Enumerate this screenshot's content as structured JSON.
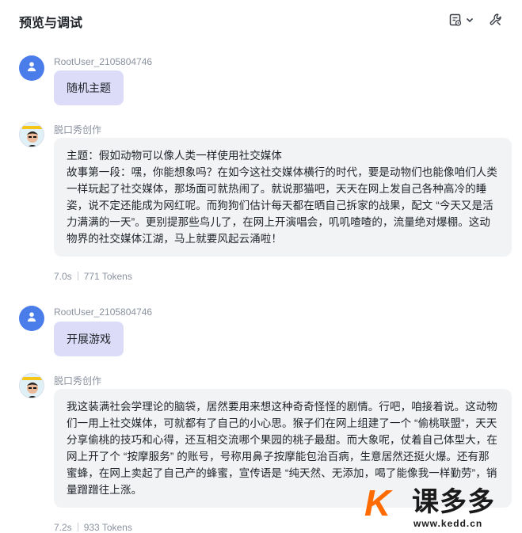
{
  "header": {
    "title": "预览与调试",
    "icons": [
      "settings-list-icon",
      "chevron-down-icon",
      "wrench-icon"
    ]
  },
  "messages": [
    {
      "role": "user",
      "sender": "RootUser_2105804746",
      "text": "随机主题"
    },
    {
      "role": "bot",
      "sender": "脱口秀创作",
      "text": "主题：假如动物可以像人类一样使用社交媒体\n故事第一段：嘿，你能想象吗？在如今这社交媒体横行的时代，要是动物们也能像咱们人类一样玩起了社交媒体，那场面可就热闹了。就说那猫吧，天天在网上发自己各种高冷的睡姿，说不定还能成为网红呢。而狗狗们估计每天都在晒自己拆家的战果，配文 “今天又是活力满满的一天”。更别提那些鸟儿了，在网上开演唱会，叽叽喳喳的，流量绝对爆棚。这动物界的社交媒体江湖，马上就要风起云涌啦！",
      "time": "7.0s",
      "tokens": "771 Tokens"
    },
    {
      "role": "user",
      "sender": "RootUser_2105804746",
      "text": "开展游戏"
    },
    {
      "role": "bot",
      "sender": "脱口秀创作",
      "text": "我这装满社会学理论的脑袋，居然要用来想这种奇奇怪怪的剧情。行吧，咱接着说。这动物们一用上社交媒体，可就都有了自己的小心思。猴子们在网上组建了一个 “偷桃联盟”，天天分享偷桃的技巧和心得，还互相交流哪个果园的桃子最甜。而大象呢，仗着自己体型大，在网上开了个 “按摩服务” 的账号，号称用鼻子按摩能包治百病，生意居然还挺火爆。还有那蜜蜂，在网上卖起了自己产的蜂蜜，宣传语是 “纯天然、无添加，喝了能像我一样勤劳”，销量蹭蹭往上涨。",
      "time": "7.2s",
      "tokens": "933 Tokens"
    }
  ],
  "watermark": {
    "name": "课多多",
    "url": "www.kedd.cn"
  }
}
